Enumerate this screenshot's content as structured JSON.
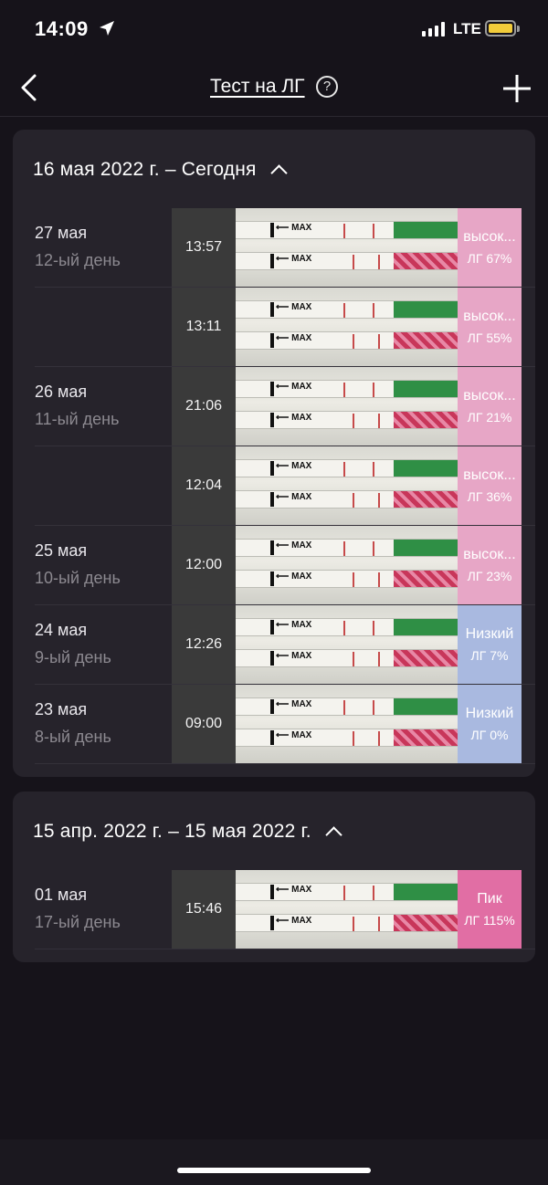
{
  "status_bar": {
    "time": "14:09",
    "network": "LTE"
  },
  "nav": {
    "title": "Тест на ЛГ",
    "help_symbol": "?"
  },
  "sections": [
    {
      "title": "16 мая 2022 г. – Сегодня",
      "rows": [
        {
          "date": "27 мая",
          "day": "12-ый день",
          "time": "13:57",
          "level": "высок...",
          "lh": "ЛГ 67%",
          "result_color": "#e7a6c6"
        },
        {
          "date": "",
          "day": "",
          "time": "13:11",
          "level": "высок...",
          "lh": "ЛГ 55%",
          "result_color": "#e7a6c6"
        },
        {
          "date": "26 мая",
          "day": "11-ый день",
          "time": "21:06",
          "level": "высок...",
          "lh": "ЛГ 21%",
          "result_color": "#e7a6c6"
        },
        {
          "date": "",
          "day": "",
          "time": "12:04",
          "level": "высок...",
          "lh": "ЛГ 36%",
          "result_color": "#e7a6c6"
        },
        {
          "date": "25 мая",
          "day": "10-ый день",
          "time": "12:00",
          "level": "высок...",
          "lh": "ЛГ 23%",
          "result_color": "#e7a6c6"
        },
        {
          "date": "24 мая",
          "day": "9-ый день",
          "time": "12:26",
          "level": "Низкий",
          "lh": "ЛГ 7%",
          "result_color": "#a9b9e0"
        },
        {
          "date": "23 мая",
          "day": "8-ый день",
          "time": "09:00",
          "level": "Низкий",
          "lh": "ЛГ 0%",
          "result_color": "#a9b9e0"
        }
      ]
    },
    {
      "title": "15 апр. 2022 г. – 15 мая 2022 г.",
      "rows": [
        {
          "date": "01 мая",
          "day": "17-ый день",
          "time": "15:46",
          "level": "Пик",
          "lh": "ЛГ 115%",
          "result_color": "#e16ea4"
        }
      ]
    }
  ],
  "strip_text": "MAX",
  "colors": {
    "background": "#16131a",
    "card": "#26232b",
    "high": "#e7a6c6",
    "low": "#a9b9e0",
    "peak": "#e16ea4"
  }
}
